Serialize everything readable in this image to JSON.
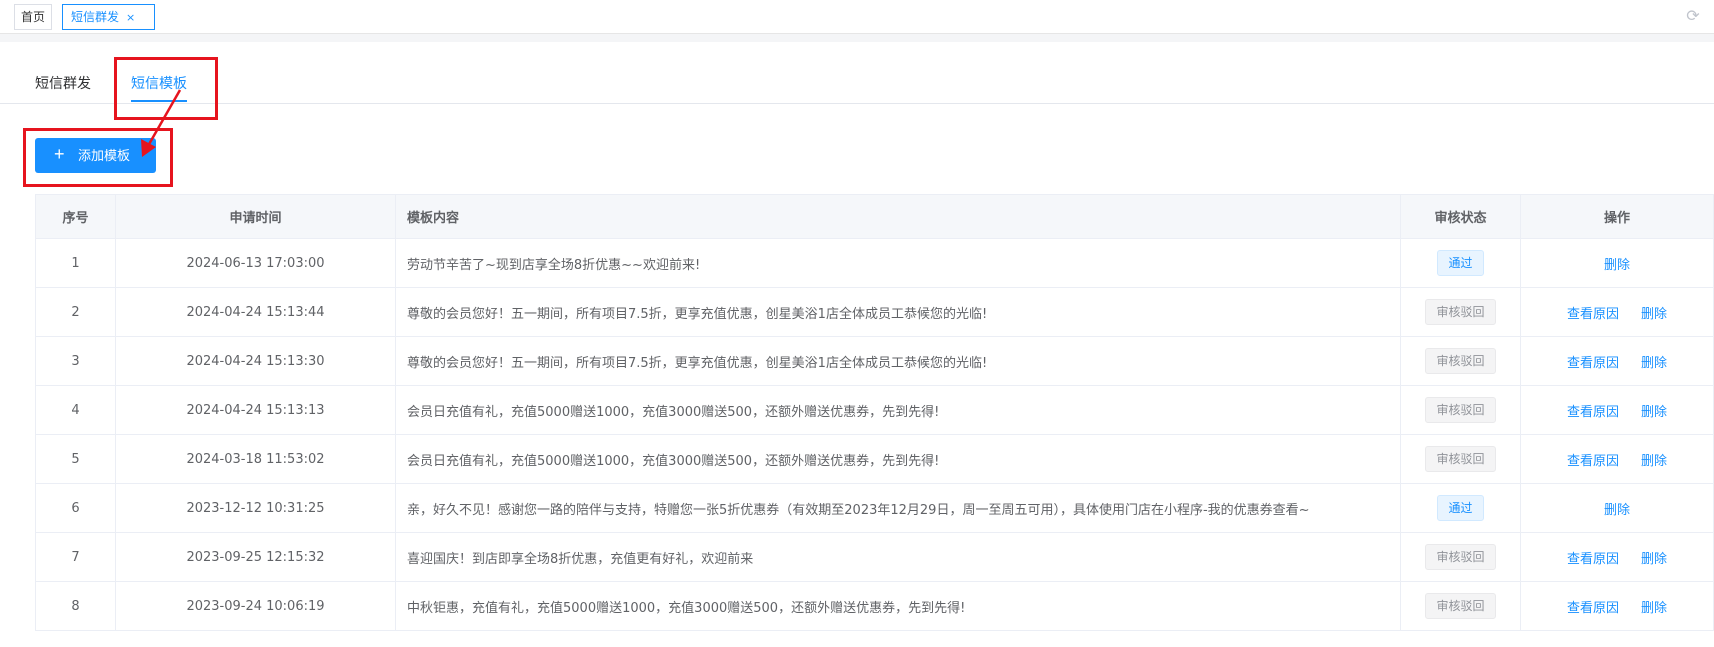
{
  "topbar": {
    "home_tab": "首页",
    "active_tab": "短信群发",
    "close_glyph": "×",
    "refresh_glyph": "⟳"
  },
  "subtabs": [
    "短信群发",
    "短信模板"
  ],
  "add_button": {
    "plus": "+",
    "label": "添加模板"
  },
  "table": {
    "headers": [
      "序号",
      "申请时间",
      "模板内容",
      "审核状态",
      "操作"
    ],
    "rows": [
      {
        "idx": "1",
        "time": "2024-06-13 17:03:00",
        "content": "劳动节辛苦了~现到店享全场8折优惠~~欢迎前来!",
        "status": "通过",
        "status_type": "pass",
        "reason": "",
        "delete": "删除"
      },
      {
        "idx": "2",
        "time": "2024-04-24 15:13:44",
        "content": "尊敬的会员您好！五一期间，所有项目7.5折，更享充值优惠，创星美浴1店全体成员工恭候您的光临!",
        "status": "审核驳回",
        "status_type": "reject",
        "reason": "查看原因",
        "delete": "删除"
      },
      {
        "idx": "3",
        "time": "2024-04-24 15:13:30",
        "content": "尊敬的会员您好！五一期间，所有项目7.5折，更享充值优惠，创星美浴1店全体成员工恭候您的光临!",
        "status": "审核驳回",
        "status_type": "reject",
        "reason": "查看原因",
        "delete": "删除"
      },
      {
        "idx": "4",
        "time": "2024-04-24 15:13:13",
        "content": "会员日充值有礼，充值5000赠送1000，充值3000赠送500，还额外赠送优惠券，先到先得!",
        "status": "审核驳回",
        "status_type": "reject",
        "reason": "查看原因",
        "delete": "删除"
      },
      {
        "idx": "5",
        "time": "2024-03-18 11:53:02",
        "content": "会员日充值有礼，充值5000赠送1000，充值3000赠送500，还额外赠送优惠券，先到先得!",
        "status": "审核驳回",
        "status_type": "reject",
        "reason": "查看原因",
        "delete": "删除"
      },
      {
        "idx": "6",
        "time": "2023-12-12 10:31:25",
        "content": "亲，好久不见！感谢您一路的陪伴与支持，特赠您一张5折优惠券（有效期至2023年12月29日，周一至周五可用），具体使用门店在小程序-我的优惠券查看~",
        "status": "通过",
        "status_type": "pass",
        "reason": "",
        "delete": "删除"
      },
      {
        "idx": "7",
        "time": "2023-09-25 12:15:32",
        "content": "喜迎国庆！到店即享全场8折优惠，充值更有好礼，欢迎前来",
        "status": "审核驳回",
        "status_type": "reject",
        "reason": "查看原因",
        "delete": "删除"
      },
      {
        "idx": "8",
        "time": "2023-09-24 10:06:19",
        "content": "中秋钜惠，充值有礼，充值5000赠送1000，充值3000赠送500，还额外赠送优惠券，先到先得!",
        "status": "审核驳回",
        "status_type": "reject",
        "reason": "查看原因",
        "delete": "删除"
      }
    ]
  },
  "colors": {
    "accent": "#1890ff",
    "annotation": "#e6141e"
  }
}
